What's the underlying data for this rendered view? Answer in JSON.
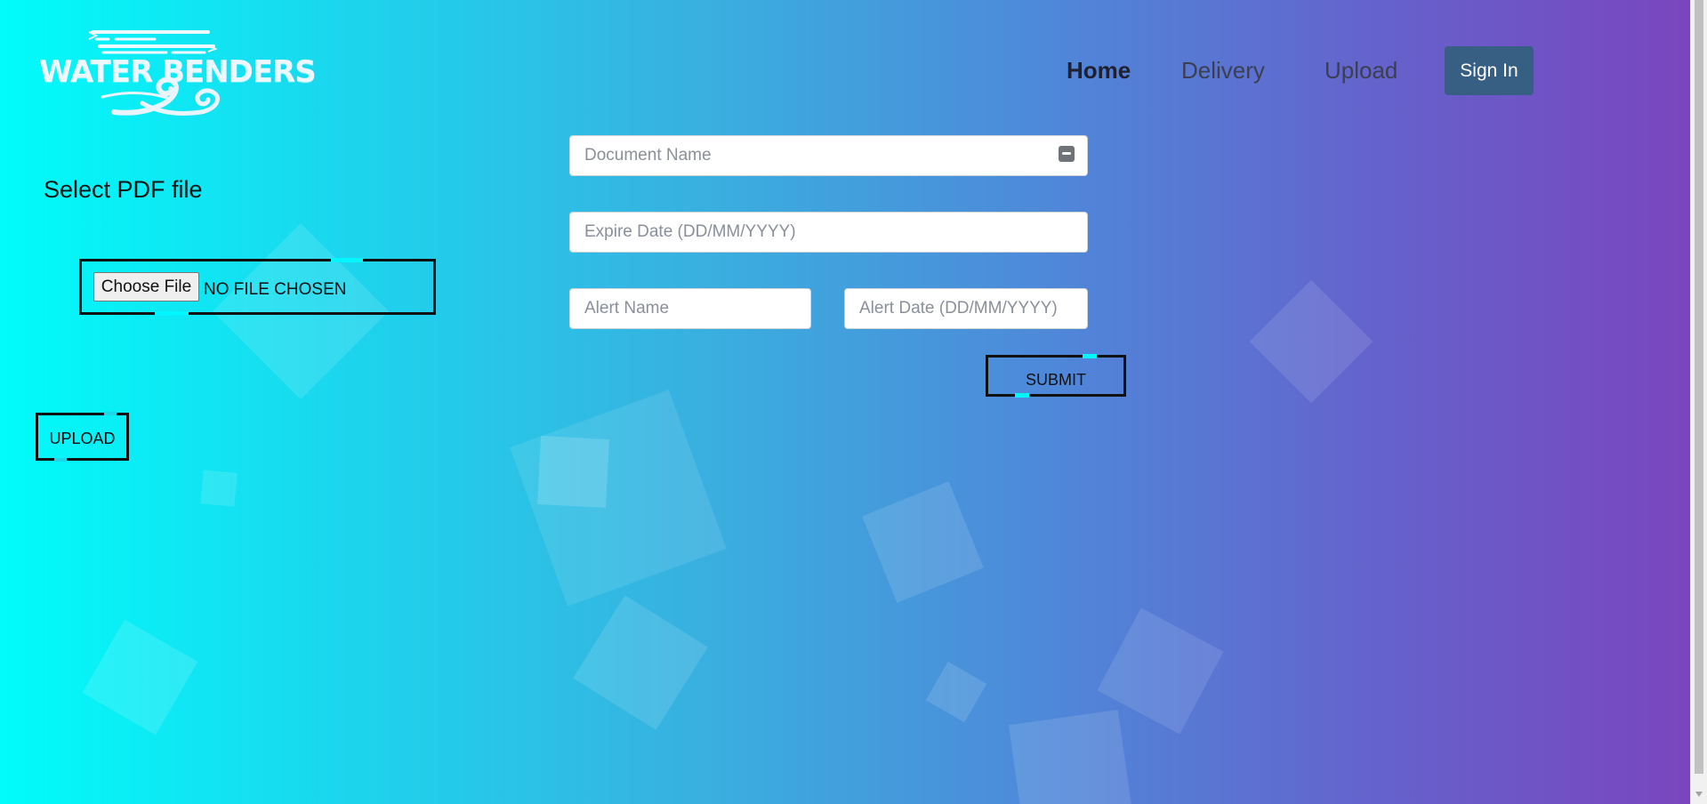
{
  "logo": {
    "text": "WATER BENDERS"
  },
  "nav": {
    "home": "Home",
    "delivery": "Delivery",
    "upload": "Upload",
    "sign_in": "Sign In"
  },
  "upload_panel": {
    "title": "Select PDF file",
    "choose_file": "Choose File",
    "file_status": "NO FILE CHOSEN",
    "upload_button": "UPLOAD"
  },
  "form": {
    "document_name_placeholder": "Document Name",
    "expire_date_placeholder": "Expire Date (DD/MM/YYYY)",
    "alert_name_placeholder": "Alert Name",
    "alert_date_placeholder": "Alert Date (DD/MM/YYYY)",
    "submit_label": "SUBMIT"
  },
  "icons": {
    "document_field_icon": "password-manager-icon"
  },
  "colors": {
    "background_start": "#00fcfb",
    "background_end": "#7b44bd",
    "frame_accent": "#00f7ff",
    "sign_in_button": "#375f84"
  }
}
